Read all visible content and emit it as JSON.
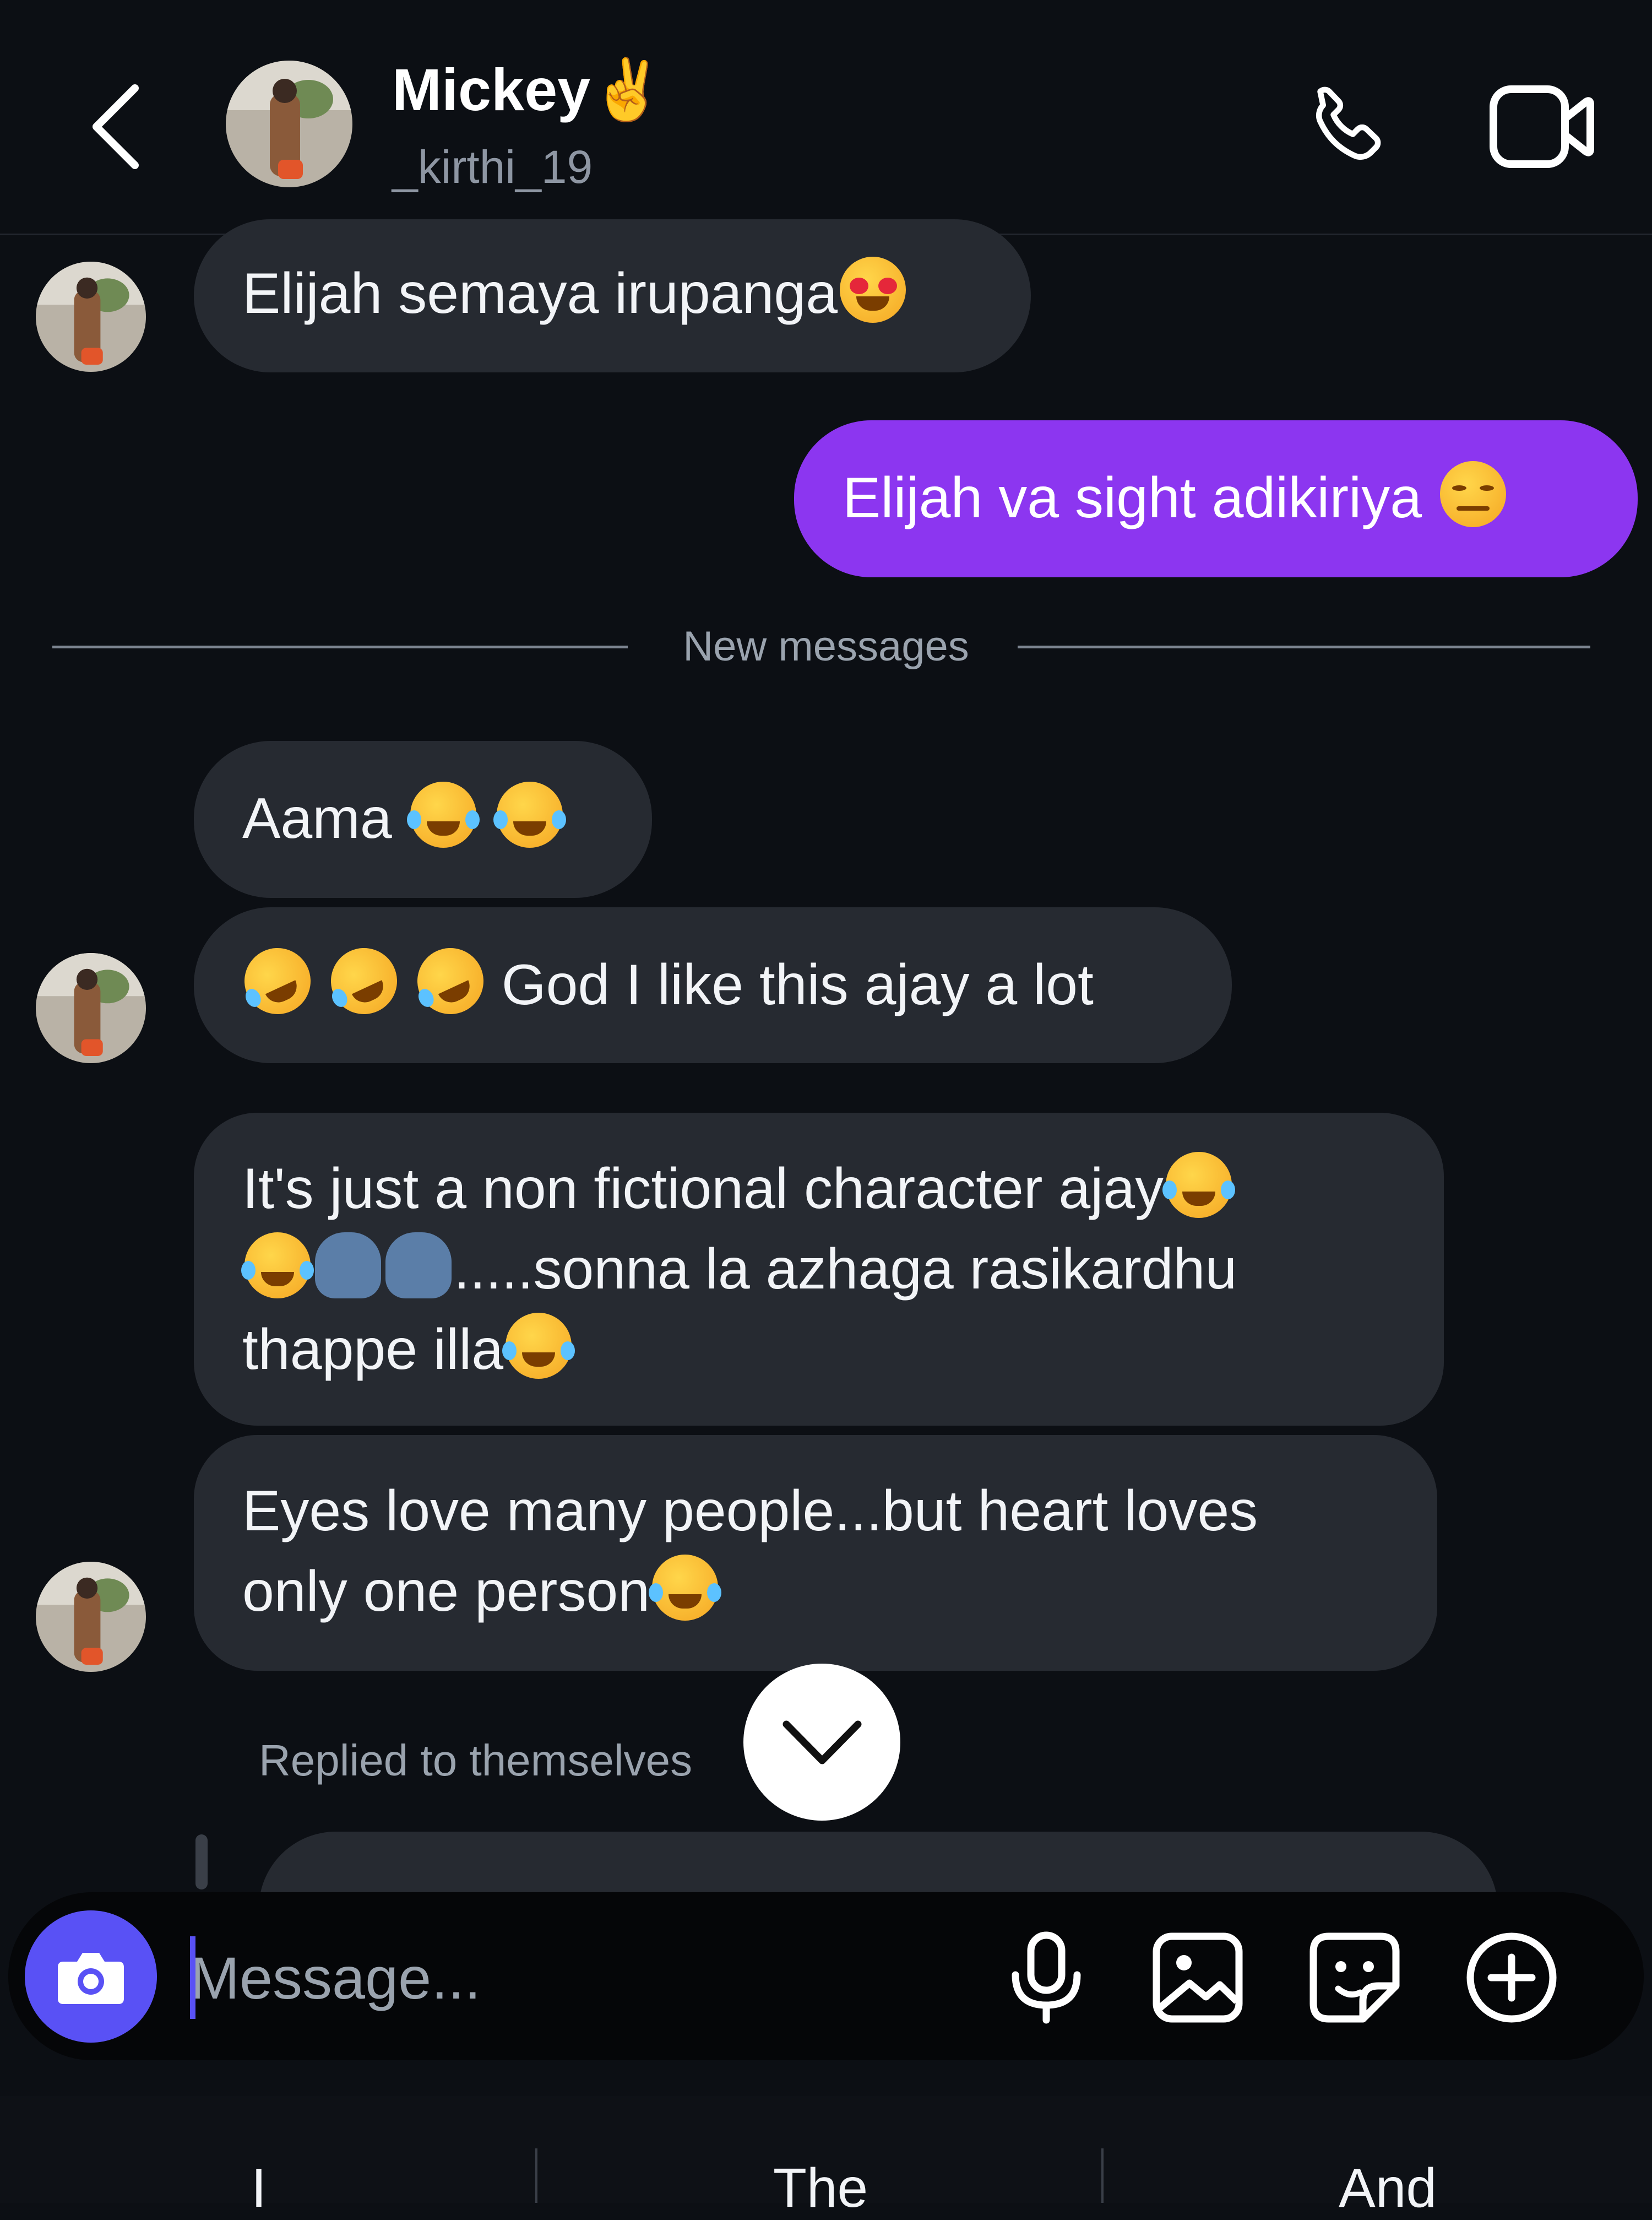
{
  "header": {
    "contact_name": "Mickey✌️",
    "contact_handle": "_kirthi_19"
  },
  "messages": [
    {
      "id": "m1",
      "direction": "received",
      "text": "Elijah semaya irupanga",
      "emoji_after": [
        "heart-eyes"
      ]
    },
    {
      "id": "m2",
      "direction": "sent",
      "text": "Elijah va sight adikiriya",
      "emoji_after": [
        "unamused"
      ]
    },
    {
      "id": "m3",
      "direction": "received",
      "text": "Aama",
      "emoji_after": [
        "joy",
        "joy"
      ]
    },
    {
      "id": "m4",
      "direction": "received",
      "emoji_before": [
        "rofl",
        "rofl",
        "rofl"
      ],
      "text": "God I like this ajay a lot"
    },
    {
      "id": "m5",
      "direction": "received",
      "lines": [
        "It's just a non fictional character ajay",
        ".....sonna la azhaga rasikardhu",
        "thappe illa"
      ]
    },
    {
      "id": "m6",
      "direction": "received",
      "lines": [
        "Eyes love many people...but heart loves",
        "only one person"
      ]
    }
  ],
  "divider": {
    "label": "New messages"
  },
  "reply_context": {
    "label": "Replied to themselves"
  },
  "composer": {
    "placeholder": "Message..."
  },
  "keyboard_suggestions": [
    "I",
    "The",
    "And"
  ],
  "colors": {
    "background": "#0c0f14",
    "received_bubble": "#262a31",
    "sent_bubble": "#8c36f0",
    "camera_button": "#5951f5",
    "muted_text": "#9aa3ae"
  },
  "icons": [
    "chevron-left-icon",
    "phone-icon",
    "video-camera-icon",
    "chevron-down-icon",
    "camera-icon",
    "microphone-icon",
    "image-icon",
    "sticker-icon",
    "plus-circle-icon"
  ]
}
